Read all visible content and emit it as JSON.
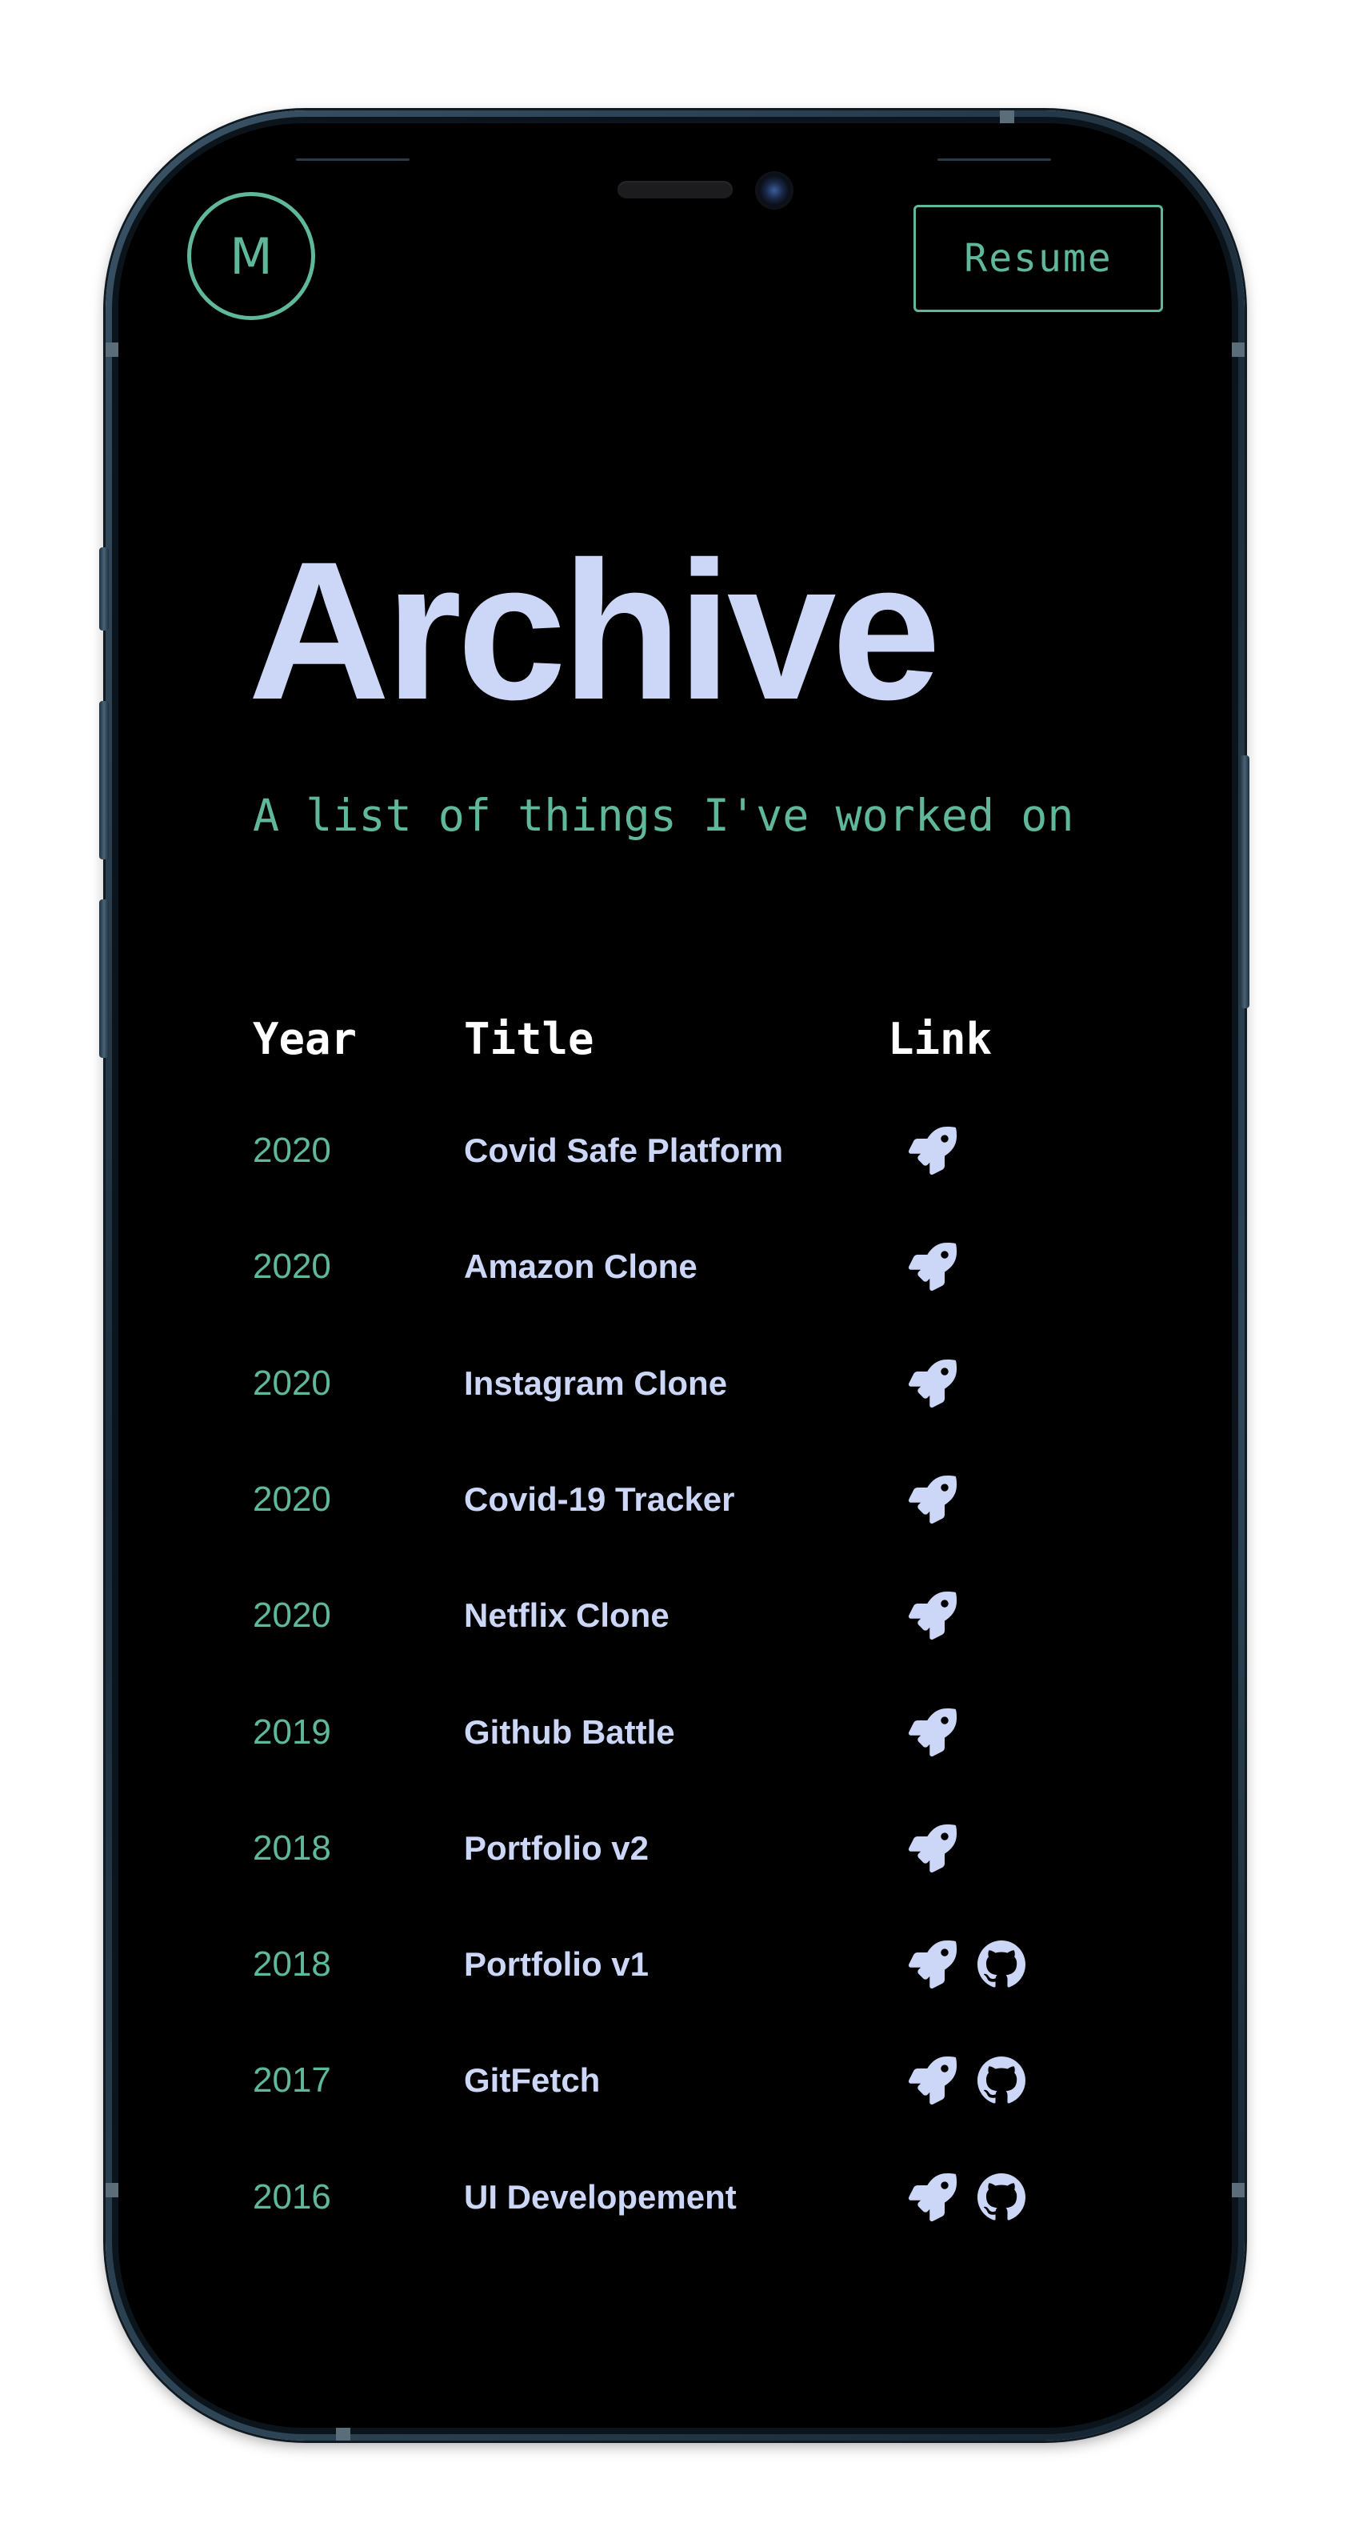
{
  "header": {
    "logo_letter": "M",
    "resume_label": "Resume"
  },
  "hero": {
    "title": "Archive",
    "subtitle": "A list of things I've worked on"
  },
  "table": {
    "headers": {
      "year": "Year",
      "title": "Title",
      "link": "Link"
    },
    "rows": [
      {
        "year": "2020",
        "title": "Covid Safe Platform",
        "links": [
          "rocket-icon"
        ]
      },
      {
        "year": "2020",
        "title": "Amazon Clone",
        "links": [
          "rocket-icon"
        ]
      },
      {
        "year": "2020",
        "title": "Instagram Clone",
        "links": [
          "rocket-icon"
        ]
      },
      {
        "year": "2020",
        "title": "Covid-19 Tracker",
        "links": [
          "rocket-icon"
        ]
      },
      {
        "year": "2020",
        "title": "Netflix Clone",
        "links": [
          "rocket-icon"
        ]
      },
      {
        "year": "2019",
        "title": "Github Battle",
        "links": [
          "rocket-icon"
        ]
      },
      {
        "year": "2018",
        "title": "Portfolio v2",
        "links": [
          "rocket-icon"
        ]
      },
      {
        "year": "2018",
        "title": "Portfolio v1",
        "links": [
          "rocket-icon",
          "github-icon"
        ]
      },
      {
        "year": "2017",
        "title": "GitFetch",
        "links": [
          "rocket-icon",
          "github-icon"
        ]
      },
      {
        "year": "2016",
        "title": "UI Developement",
        "links": [
          "rocket-icon",
          "github-icon"
        ]
      }
    ]
  },
  "colors": {
    "background": "#000000",
    "accent": "#5fb89a",
    "title_text": "#ccd6f6",
    "header_text": "#ffffff"
  }
}
